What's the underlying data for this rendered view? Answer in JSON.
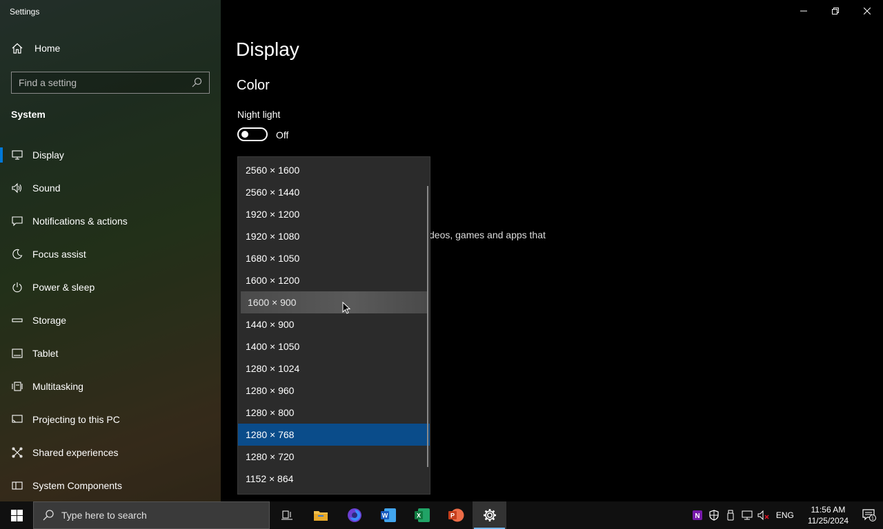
{
  "app": {
    "title": "Settings"
  },
  "sidebar": {
    "home_label": "Home",
    "search_placeholder": "Find a setting",
    "section": "System",
    "items": [
      {
        "label": "Display",
        "icon": "monitor-icon",
        "active": true
      },
      {
        "label": "Sound",
        "icon": "speaker-icon"
      },
      {
        "label": "Notifications & actions",
        "icon": "message-icon"
      },
      {
        "label": "Focus assist",
        "icon": "moon-icon"
      },
      {
        "label": "Power & sleep",
        "icon": "power-icon"
      },
      {
        "label": "Storage",
        "icon": "storage-icon"
      },
      {
        "label": "Tablet",
        "icon": "tablet-icon"
      },
      {
        "label": "Multitasking",
        "icon": "multitasking-icon"
      },
      {
        "label": "Projecting to this PC",
        "icon": "projecting-icon"
      },
      {
        "label": "Shared experiences",
        "icon": "shared-icon"
      },
      {
        "label": "System Components",
        "icon": "components-icon"
      }
    ]
  },
  "main": {
    "title": "Display",
    "color_heading": "Color",
    "night_light_label": "Night light",
    "night_light_state": "Off",
    "partial_text": "deos, games and apps that"
  },
  "resolution_dropdown": {
    "options": [
      "2560 × 1600",
      "2560 × 1440",
      "1920 × 1200",
      "1920 × 1080",
      "1680 × 1050",
      "1600 × 1200",
      "1600 × 900",
      "1440 × 900",
      "1400 × 1050",
      "1280 × 1024",
      "1280 × 960",
      "1280 × 800",
      "1280 × 768",
      "1280 × 720",
      "1152 × 864"
    ],
    "hovered": "1600 × 900",
    "selected": "1280 × 768"
  },
  "taskbar": {
    "search_placeholder": "Type here to search",
    "apps": [
      "task-view-icon",
      "file-explorer-icon",
      "firefox-icon",
      "word-icon",
      "excel-icon",
      "powerpoint-icon",
      "settings-icon"
    ],
    "language": "ENG",
    "time": "11:56 AM",
    "date": "11/25/2024",
    "notification_count": "1"
  },
  "colors": {
    "accent": "#0078d7",
    "selected": "#0a4c8a"
  }
}
